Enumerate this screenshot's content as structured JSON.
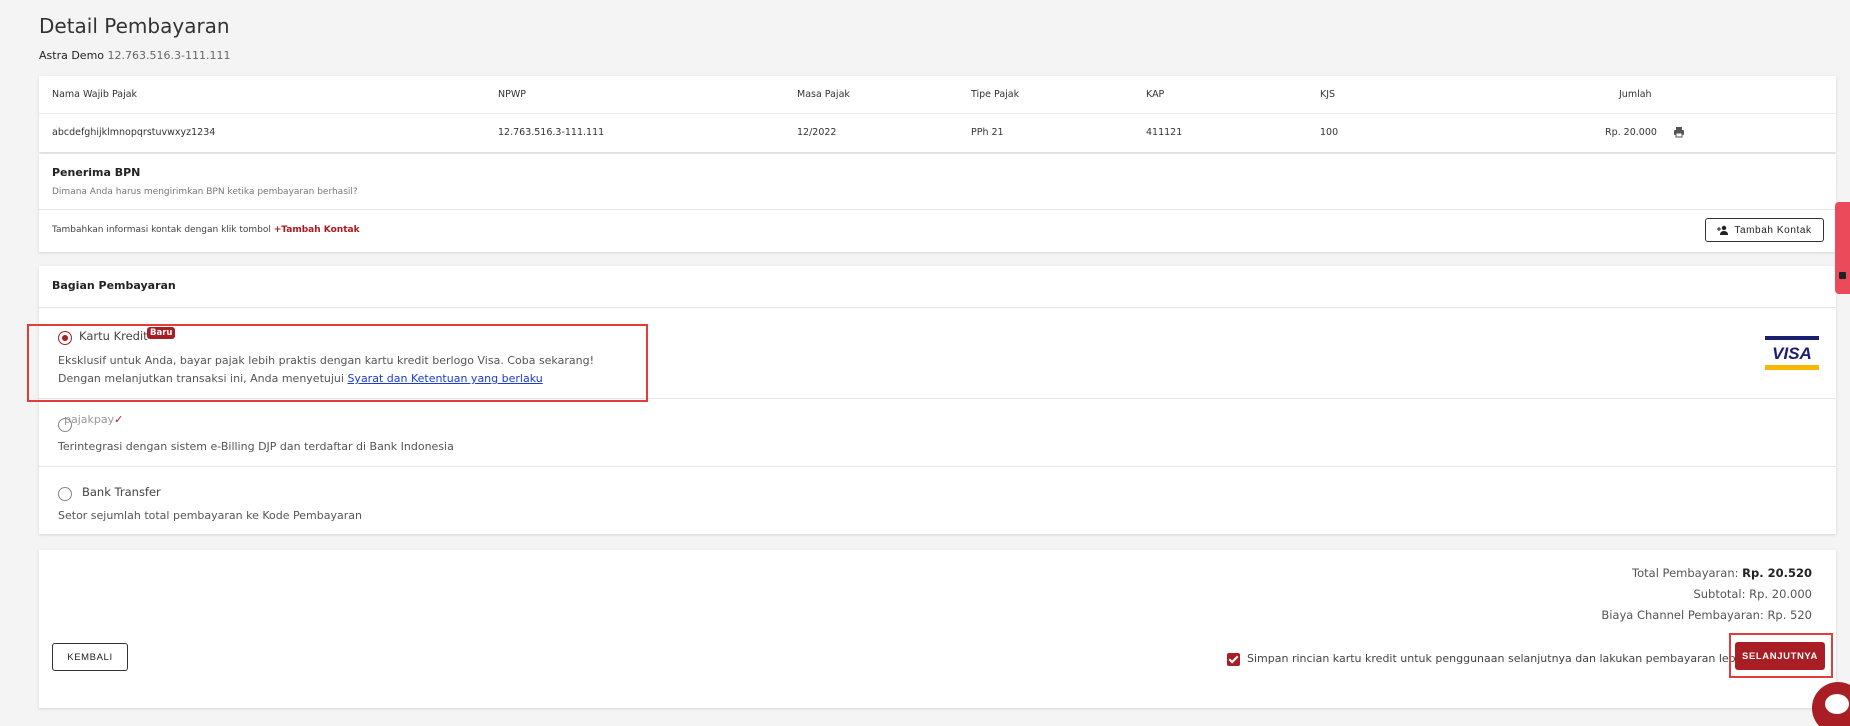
{
  "page": {
    "title": "Detail Pembayaran",
    "company_name": "Astra Demo",
    "company_npwp": "12.763.516.3-111.111"
  },
  "table": {
    "headers": [
      "Nama Wajib Pajak",
      "NPWP",
      "Masa Pajak",
      "Tipe Pajak",
      "KAP",
      "KJS",
      "Jumlah"
    ],
    "row": [
      "abcdefghijklmnopqrstuvwxyz1234",
      "12.763.516.3-111.111",
      "12/2022",
      "PPh 21",
      "411121",
      "100",
      "Rp. 20.000"
    ]
  },
  "bpn": {
    "title": "Penerima BPN",
    "subtitle": "Dimana Anda harus mengirimkan BPN ketika pembayaran berhasil?",
    "hint_prefix": "Tambahkan informasi kontak dengan klik tombol",
    "hint_link": "+Tambah Kontak",
    "button_label": "Tambah Kontak"
  },
  "payment": {
    "title": "Bagian Pembayaran",
    "credit_card": {
      "label": "Kartu Kredit",
      "badge": "Baru",
      "desc1": "Eksklusif untuk Anda, bayar pajak lebih praktis dengan kartu kredit berlogo Visa. Coba sekarang!",
      "desc2_prefix": "Dengan melanjutkan transaksi ini, Anda menyetujui",
      "desc2_link": "Syarat dan Ketentuan yang berlaku",
      "brand": "VISA",
      "selected": true
    },
    "pajakpay": {
      "logo_text": "pajakpay",
      "desc": "Terintegrasi dengan sistem e-Billing DJP dan terdaftar di Bank Indonesia"
    },
    "bank_transfer": {
      "label": "Bank Transfer",
      "desc": "Setor sejumlah total pembayaran ke Kode Pembayaran"
    }
  },
  "summary": {
    "total_label": "Total Pembayaran:",
    "total_value": "Rp. 20.520",
    "subtotal_label": "Subtotal:",
    "subtotal_value": "Rp. 20.000",
    "channel_label": "Biaya Channel Pembayaran:",
    "channel_value": "Rp. 520",
    "back_label": "KEMBALI",
    "save_card_text": "Simpan rincian kartu kredit untuk penggunaan selanjutnya dan lakukan pembayaran lebih cepat",
    "next_label": "SELANJUTNYA"
  },
  "colors": {
    "brand_red": "#a81e24",
    "highlight": "#e23c3c",
    "link_blue": "#1a3bd6"
  }
}
